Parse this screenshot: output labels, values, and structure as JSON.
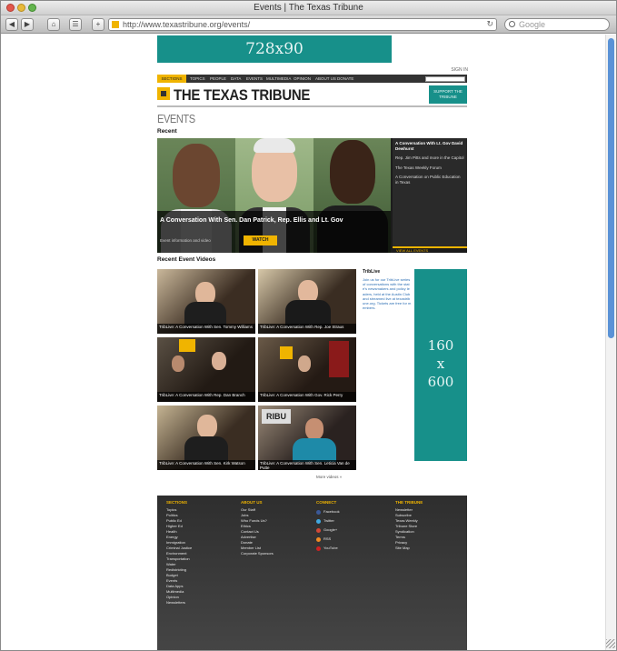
{
  "window": {
    "title": "Events | The Texas Tribune"
  },
  "toolbar": {
    "url": "http://www.texastribune.org/events/",
    "search_placeholder": "Google"
  },
  "ads": {
    "top": "728x90",
    "side": [
      "160",
      "x",
      "600"
    ]
  },
  "header": {
    "nav_first": "SECTIONS",
    "nav_items": [
      "TOPICS",
      "PEOPLE",
      "DATA",
      "EVENTS",
      "MULTIMEDIA",
      "OPINION",
      "ABOUT US",
      "DONATE"
    ],
    "logo": "THE TEXAS TRIBUNE",
    "logo_button": "SUPPORT THE TRIBUNE",
    "utility": "SIGN IN"
  },
  "main": {
    "section_title": "EVENTS",
    "featured_label": "Recent",
    "hero": {
      "caption": "A Conversation With Sen. Dan Patrick, Rep. Ellis and Lt. Gov",
      "meta": "Event information and video",
      "button": "WATCH",
      "side_items": [
        "A Conversation With Lt. Gov David Dewhurst",
        "Rep. Jim Pitts and more in the Capitol",
        "The Texas Weekly Forum",
        "A Conversation on Public Education in Texas"
      ],
      "side_bar": "VIEW ALL EVENTS"
    },
    "videos_title": "Recent Event Videos",
    "videos": [
      {
        "caption": "TribLive: A Conversation With Sen. Tommy Williams"
      },
      {
        "caption": "TribLive: A Conversation With Rep. Joe Straus"
      },
      {
        "caption": "TribLive: A Conversation With Rep. Dan Branch"
      },
      {
        "caption": "TribLive: A Conversation With Gov. Rick Perry"
      },
      {
        "caption": "TribLive: A Conversation With Sen. Kirk Watson"
      },
      {
        "caption": "TribLive: A Conversation With Sen. Leticia Van de Putte"
      }
    ],
    "more_link": "More videos »",
    "list_title": "TribLive",
    "list_text": "Join us for our TribLive series of conversations with the state's newsmakers and policy leaders, held at the Austin Club and streamed live at texastribune.org. Tickets are free for members."
  },
  "footer": {
    "columns": [
      {
        "head": "SECTIONS",
        "links": [
          "Topics",
          "Politics",
          "Public Ed",
          "Higher Ed",
          "Health",
          "Energy",
          "Immigration",
          "Criminal Justice",
          "Environment",
          "Transportation",
          "Water",
          "Redistricting",
          "Budget",
          "Events",
          "Data Apps",
          "Multimedia",
          "Opinion",
          "Newsletters"
        ]
      },
      {
        "head": "ABOUT US",
        "links": [
          "Our Staff",
          "Jobs",
          "Who Funds Us?",
          "Ethics",
          "Contact Us",
          "Advertise",
          "Donate",
          "Member List",
          "Corporate Sponsors"
        ]
      },
      {
        "head": "CONNECT",
        "social": [
          {
            "label": "Facebook",
            "color": "#3b5998"
          },
          {
            "label": "Twitter",
            "color": "#41a9e1"
          },
          {
            "label": "Google+",
            "color": "#d14836"
          },
          {
            "label": "RSS",
            "color": "#f08a24"
          },
          {
            "label": "YouTube",
            "color": "#cc2222"
          }
        ]
      },
      {
        "head": "THE TRIBUNE",
        "links": [
          "Newsletter",
          "Subscribe",
          "Texas Weekly",
          "Tribune Store",
          "Syndication",
          "Terms",
          "Privacy",
          "Site Map"
        ]
      }
    ]
  }
}
